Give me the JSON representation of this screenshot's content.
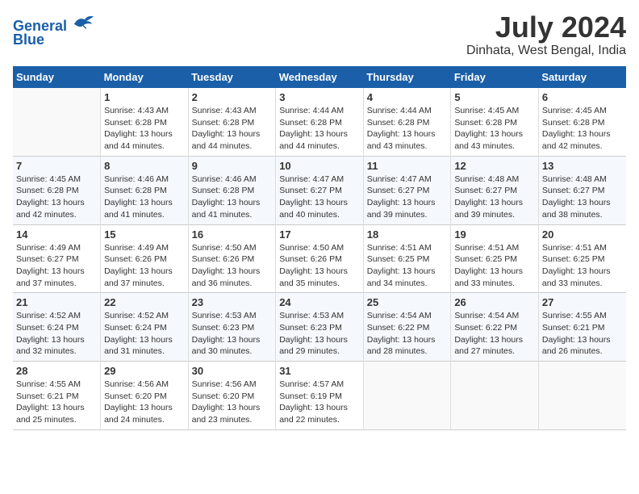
{
  "header": {
    "logo_line1": "General",
    "logo_line2": "Blue",
    "month": "July 2024",
    "location": "Dinhata, West Bengal, India"
  },
  "days_of_week": [
    "Sunday",
    "Monday",
    "Tuesday",
    "Wednesday",
    "Thursday",
    "Friday",
    "Saturday"
  ],
  "weeks": [
    [
      {
        "day": "",
        "info": ""
      },
      {
        "day": "1",
        "info": "Sunrise: 4:43 AM\nSunset: 6:28 PM\nDaylight: 13 hours\nand 44 minutes."
      },
      {
        "day": "2",
        "info": "Sunrise: 4:43 AM\nSunset: 6:28 PM\nDaylight: 13 hours\nand 44 minutes."
      },
      {
        "day": "3",
        "info": "Sunrise: 4:44 AM\nSunset: 6:28 PM\nDaylight: 13 hours\nand 44 minutes."
      },
      {
        "day": "4",
        "info": "Sunrise: 4:44 AM\nSunset: 6:28 PM\nDaylight: 13 hours\nand 43 minutes."
      },
      {
        "day": "5",
        "info": "Sunrise: 4:45 AM\nSunset: 6:28 PM\nDaylight: 13 hours\nand 43 minutes."
      },
      {
        "day": "6",
        "info": "Sunrise: 4:45 AM\nSunset: 6:28 PM\nDaylight: 13 hours\nand 42 minutes."
      }
    ],
    [
      {
        "day": "7",
        "info": "Sunrise: 4:45 AM\nSunset: 6:28 PM\nDaylight: 13 hours\nand 42 minutes."
      },
      {
        "day": "8",
        "info": "Sunrise: 4:46 AM\nSunset: 6:28 PM\nDaylight: 13 hours\nand 41 minutes."
      },
      {
        "day": "9",
        "info": "Sunrise: 4:46 AM\nSunset: 6:28 PM\nDaylight: 13 hours\nand 41 minutes."
      },
      {
        "day": "10",
        "info": "Sunrise: 4:47 AM\nSunset: 6:27 PM\nDaylight: 13 hours\nand 40 minutes."
      },
      {
        "day": "11",
        "info": "Sunrise: 4:47 AM\nSunset: 6:27 PM\nDaylight: 13 hours\nand 39 minutes."
      },
      {
        "day": "12",
        "info": "Sunrise: 4:48 AM\nSunset: 6:27 PM\nDaylight: 13 hours\nand 39 minutes."
      },
      {
        "day": "13",
        "info": "Sunrise: 4:48 AM\nSunset: 6:27 PM\nDaylight: 13 hours\nand 38 minutes."
      }
    ],
    [
      {
        "day": "14",
        "info": "Sunrise: 4:49 AM\nSunset: 6:27 PM\nDaylight: 13 hours\nand 37 minutes."
      },
      {
        "day": "15",
        "info": "Sunrise: 4:49 AM\nSunset: 6:26 PM\nDaylight: 13 hours\nand 37 minutes."
      },
      {
        "day": "16",
        "info": "Sunrise: 4:50 AM\nSunset: 6:26 PM\nDaylight: 13 hours\nand 36 minutes."
      },
      {
        "day": "17",
        "info": "Sunrise: 4:50 AM\nSunset: 6:26 PM\nDaylight: 13 hours\nand 35 minutes."
      },
      {
        "day": "18",
        "info": "Sunrise: 4:51 AM\nSunset: 6:25 PM\nDaylight: 13 hours\nand 34 minutes."
      },
      {
        "day": "19",
        "info": "Sunrise: 4:51 AM\nSunset: 6:25 PM\nDaylight: 13 hours\nand 33 minutes."
      },
      {
        "day": "20",
        "info": "Sunrise: 4:51 AM\nSunset: 6:25 PM\nDaylight: 13 hours\nand 33 minutes."
      }
    ],
    [
      {
        "day": "21",
        "info": "Sunrise: 4:52 AM\nSunset: 6:24 PM\nDaylight: 13 hours\nand 32 minutes."
      },
      {
        "day": "22",
        "info": "Sunrise: 4:52 AM\nSunset: 6:24 PM\nDaylight: 13 hours\nand 31 minutes."
      },
      {
        "day": "23",
        "info": "Sunrise: 4:53 AM\nSunset: 6:23 PM\nDaylight: 13 hours\nand 30 minutes."
      },
      {
        "day": "24",
        "info": "Sunrise: 4:53 AM\nSunset: 6:23 PM\nDaylight: 13 hours\nand 29 minutes."
      },
      {
        "day": "25",
        "info": "Sunrise: 4:54 AM\nSunset: 6:22 PM\nDaylight: 13 hours\nand 28 minutes."
      },
      {
        "day": "26",
        "info": "Sunrise: 4:54 AM\nSunset: 6:22 PM\nDaylight: 13 hours\nand 27 minutes."
      },
      {
        "day": "27",
        "info": "Sunrise: 4:55 AM\nSunset: 6:21 PM\nDaylight: 13 hours\nand 26 minutes."
      }
    ],
    [
      {
        "day": "28",
        "info": "Sunrise: 4:55 AM\nSunset: 6:21 PM\nDaylight: 13 hours\nand 25 minutes."
      },
      {
        "day": "29",
        "info": "Sunrise: 4:56 AM\nSunset: 6:20 PM\nDaylight: 13 hours\nand 24 minutes."
      },
      {
        "day": "30",
        "info": "Sunrise: 4:56 AM\nSunset: 6:20 PM\nDaylight: 13 hours\nand 23 minutes."
      },
      {
        "day": "31",
        "info": "Sunrise: 4:57 AM\nSunset: 6:19 PM\nDaylight: 13 hours\nand 22 minutes."
      },
      {
        "day": "",
        "info": ""
      },
      {
        "day": "",
        "info": ""
      },
      {
        "day": "",
        "info": ""
      }
    ]
  ]
}
